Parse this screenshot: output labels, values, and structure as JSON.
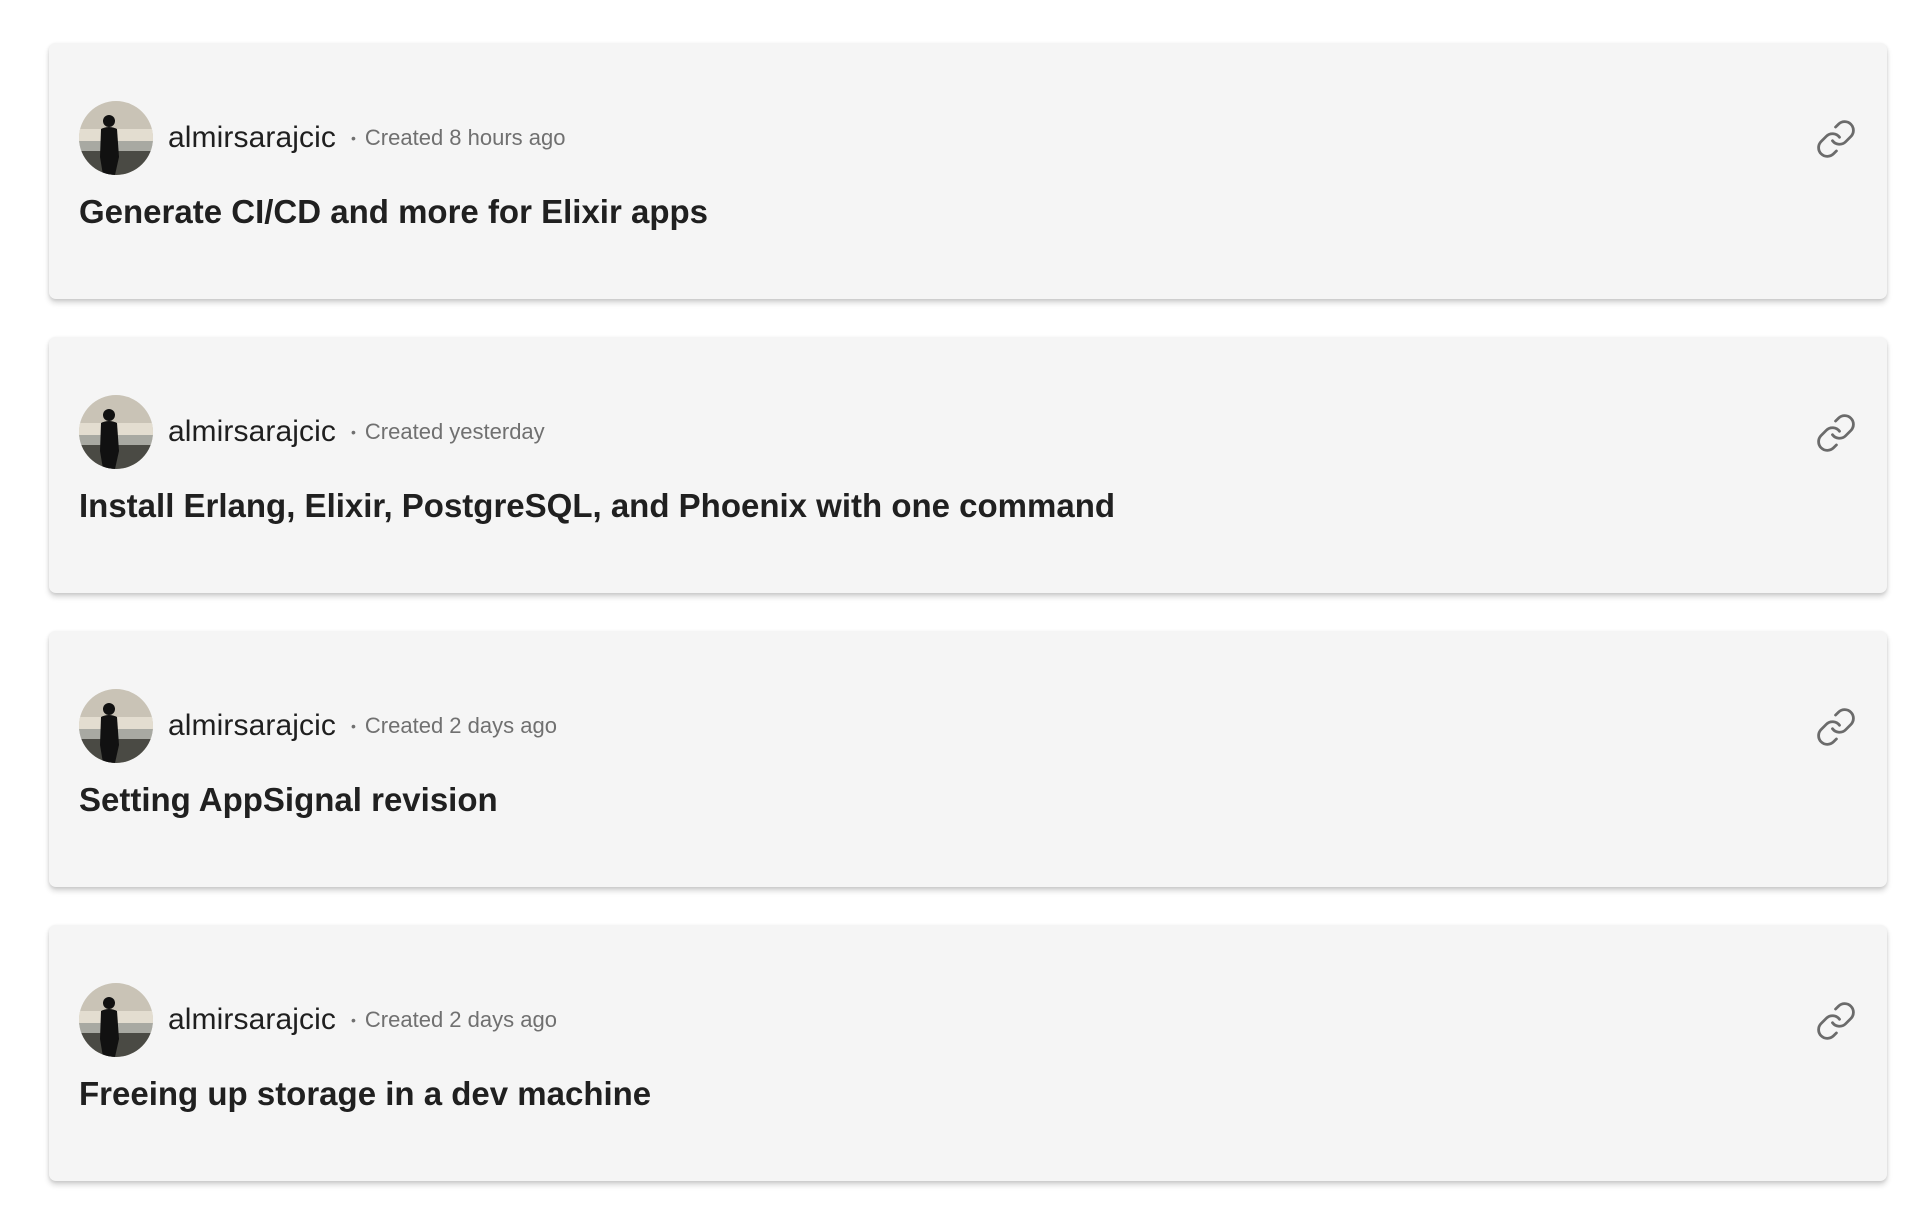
{
  "posts": [
    {
      "username": "almirsarajcic",
      "meta_separator": "•",
      "created": "Created 8 hours ago",
      "title": "Generate CI/CD and more for Elixir apps",
      "avatar_icon": "avatar-photo",
      "link_icon": "link-icon"
    },
    {
      "username": "almirsarajcic",
      "meta_separator": "•",
      "created": "Created yesterday",
      "title": "Install Erlang, Elixir, PostgreSQL, and Phoenix with one command",
      "avatar_icon": "avatar-photo",
      "link_icon": "link-icon"
    },
    {
      "username": "almirsarajcic",
      "meta_separator": "•",
      "created": "Created 2 days ago",
      "title": "Setting AppSignal revision",
      "avatar_icon": "avatar-photo",
      "link_icon": "link-icon"
    },
    {
      "username": "almirsarajcic",
      "meta_separator": "•",
      "created": "Created 2 days ago",
      "title": "Freeing up storage in a dev machine",
      "avatar_icon": "avatar-photo",
      "link_icon": "link-icon"
    }
  ],
  "colors": {
    "card_background": "#f5f5f5",
    "title_text": "#202020",
    "meta_text": "#707070",
    "icon_stroke": "#6b6b6b"
  }
}
